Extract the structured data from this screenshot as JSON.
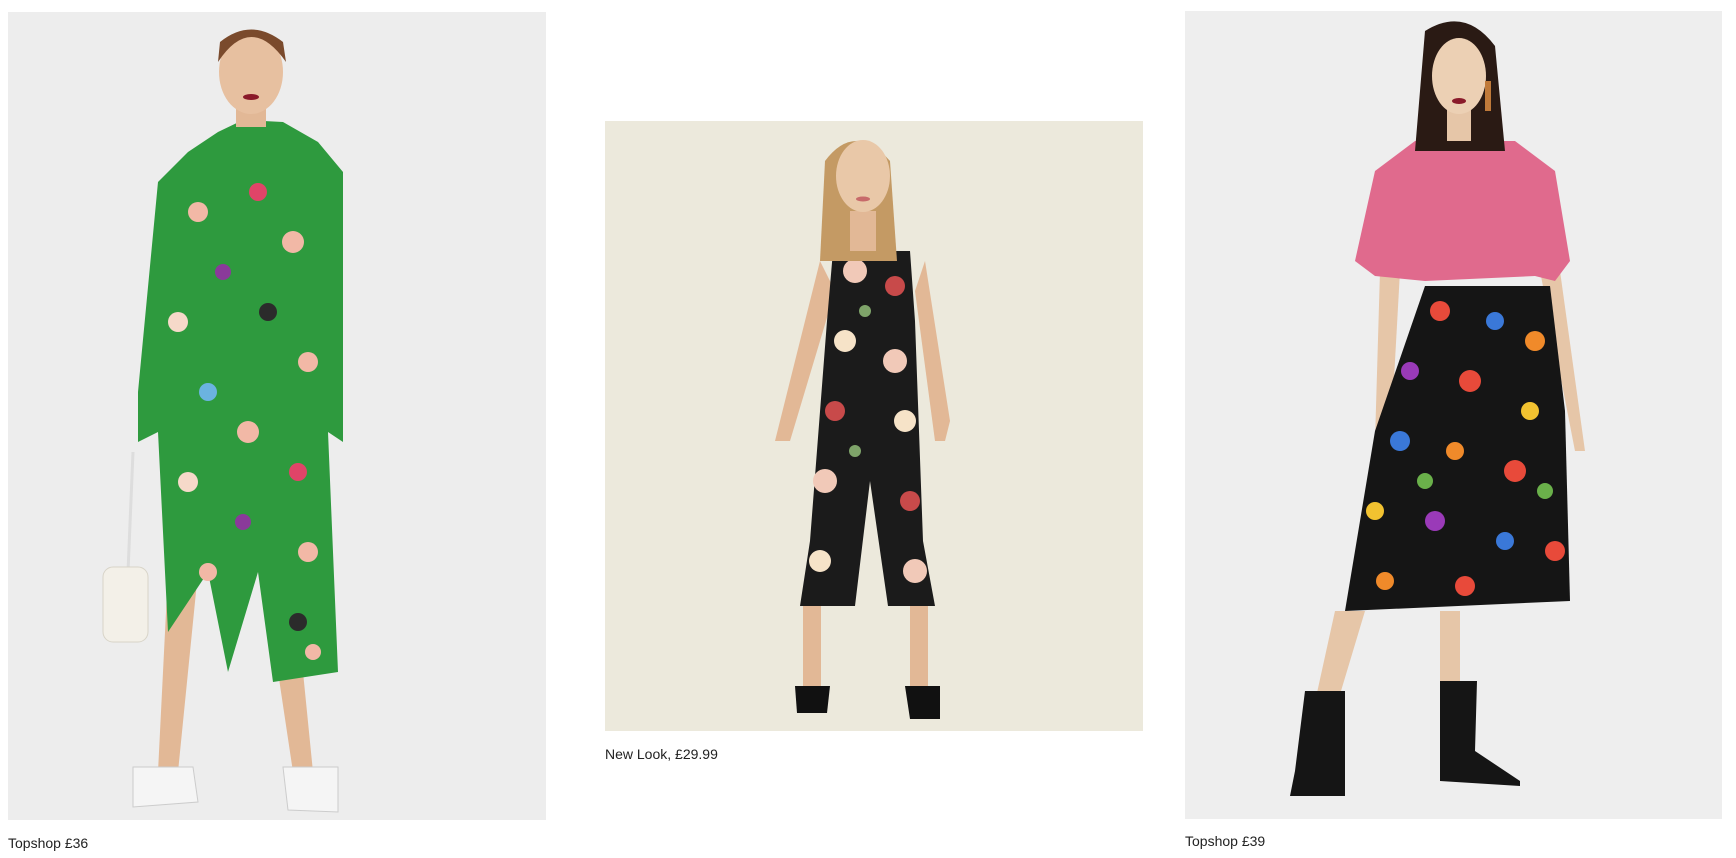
{
  "products": [
    {
      "caption": "Topshop £36",
      "image_alt": "Model wearing a green floral print long-sleeve midi dress with side slit, carrying a white beaded bag",
      "colors": {
        "background": "#ededed",
        "garment": "#2e9a3e"
      }
    },
    {
      "caption": "New Look, £29.99",
      "image_alt": "Model wearing a black floral print strappy culotte jumpsuit with black heeled sandals",
      "colors": {
        "background": "#ece9dc",
        "garment": "#1b1b1b"
      }
    },
    {
      "caption": "Topshop £39",
      "image_alt": "Model wearing a pink fluffy jumper and black multicolour floral pleated midi skirt with black ankle boots",
      "colors": {
        "background": "#eeeeee",
        "garment": "#e06a8d"
      }
    }
  ]
}
